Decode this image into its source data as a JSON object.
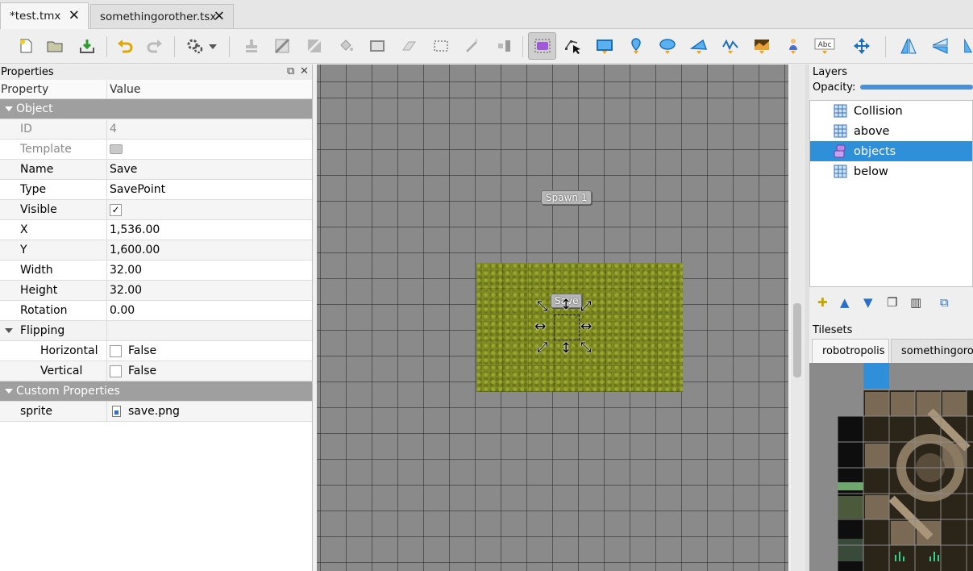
{
  "tabs": [
    {
      "label": "*test.tmx",
      "close": "✕"
    },
    {
      "label": "somethingorother.tsx",
      "close": "✕"
    }
  ],
  "properties": {
    "title": "Properties",
    "col_property": "Property",
    "col_value": "Value",
    "groups": {
      "object": "Object",
      "flipping": "Flipping",
      "custom": "Custom Properties"
    },
    "rows": {
      "id": {
        "k": "ID",
        "v": "4"
      },
      "template": {
        "k": "Template"
      },
      "name": {
        "k": "Name",
        "v": "Save"
      },
      "type": {
        "k": "Type",
        "v": "SavePoint"
      },
      "visible": {
        "k": "Visible",
        "check": "✓"
      },
      "x": {
        "k": "X",
        "v": "1,536.00"
      },
      "y": {
        "k": "Y",
        "v": "1,600.00"
      },
      "width": {
        "k": "Width",
        "v": "32.00"
      },
      "height": {
        "k": "Height",
        "v": "32.00"
      },
      "rotation": {
        "k": "Rotation",
        "v": "0.00"
      },
      "horizontal": {
        "k": "Horizontal",
        "v": "False"
      },
      "vertical": {
        "k": "Vertical",
        "v": "False"
      },
      "sprite": {
        "k": "sprite",
        "v": "save.png"
      }
    }
  },
  "canvas": {
    "spawn_label": "Spawn 1",
    "save_label": "Save"
  },
  "layers": {
    "title": "Layers",
    "opacity_label": "Opacity:",
    "items": [
      {
        "name": "Collision",
        "kind": "tile"
      },
      {
        "name": "above",
        "kind": "tile"
      },
      {
        "name": "objects",
        "kind": "object",
        "selected": true
      },
      {
        "name": "below",
        "kind": "tile"
      }
    ]
  },
  "tilesets": {
    "title": "Tilesets",
    "tabs": [
      "robotropolis",
      "somethingorother"
    ]
  },
  "colors": {
    "selection": "#2f8fd9",
    "group_header": "#9f9f9f",
    "canvas_bg": "#8a8a8a"
  }
}
